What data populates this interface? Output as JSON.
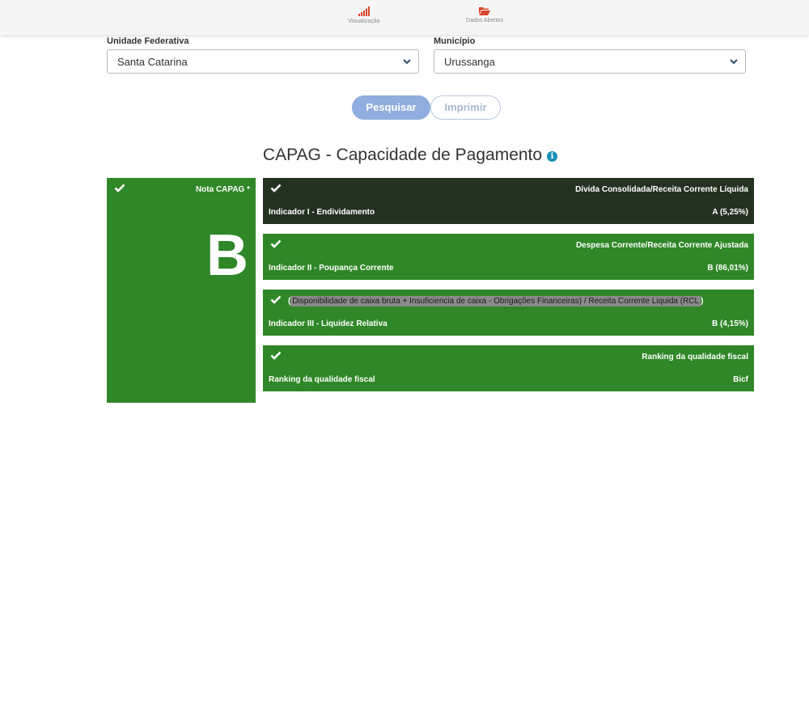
{
  "nav": {
    "visualizacao": "Visualização",
    "dados_abertos": "Dados Abertos"
  },
  "filters": {
    "uf_label": "Unidade Federativa",
    "uf_value": "Santa Catarina",
    "municipio_label": "Município",
    "municipio_value": "Urussanga"
  },
  "buttons": {
    "pesquisar": "Pesquisar",
    "imprimir": "Imprimir"
  },
  "title": "CAPAG - Capacidade de Pagamento",
  "grade": {
    "label": "Nota CAPAG *",
    "value": "B"
  },
  "indicators": [
    {
      "description": "Dívida Consolidada/Receita Corrente Líquida",
      "name": "Indicador I - Endividamento",
      "value": "A (5,25%)"
    },
    {
      "description": "Despesa Corrente/Receita Corrente Ajustada",
      "name": "Indicador II - Poupança Corrente",
      "value": "B (86,01%)"
    },
    {
      "description_open": "(",
      "description": "Disponibilidade de caixa bruta + Insuficiencia de caixa - Obrigações Financeiras) / Receita Corrente Liquida (RCL",
      "description_close": ")",
      "name": "Indicador III - Liquidez Relativa",
      "value": "B (4,15%)"
    },
    {
      "description": "Ranking da qualidade fiscal",
      "name": "Ranking da qualidade fiscal",
      "value": "Bicf"
    }
  ],
  "colors": {
    "card_green": "#2f8728",
    "card_dark": "#233220",
    "button_primary": "#8fadde",
    "nav_icon": "#d9452a"
  }
}
